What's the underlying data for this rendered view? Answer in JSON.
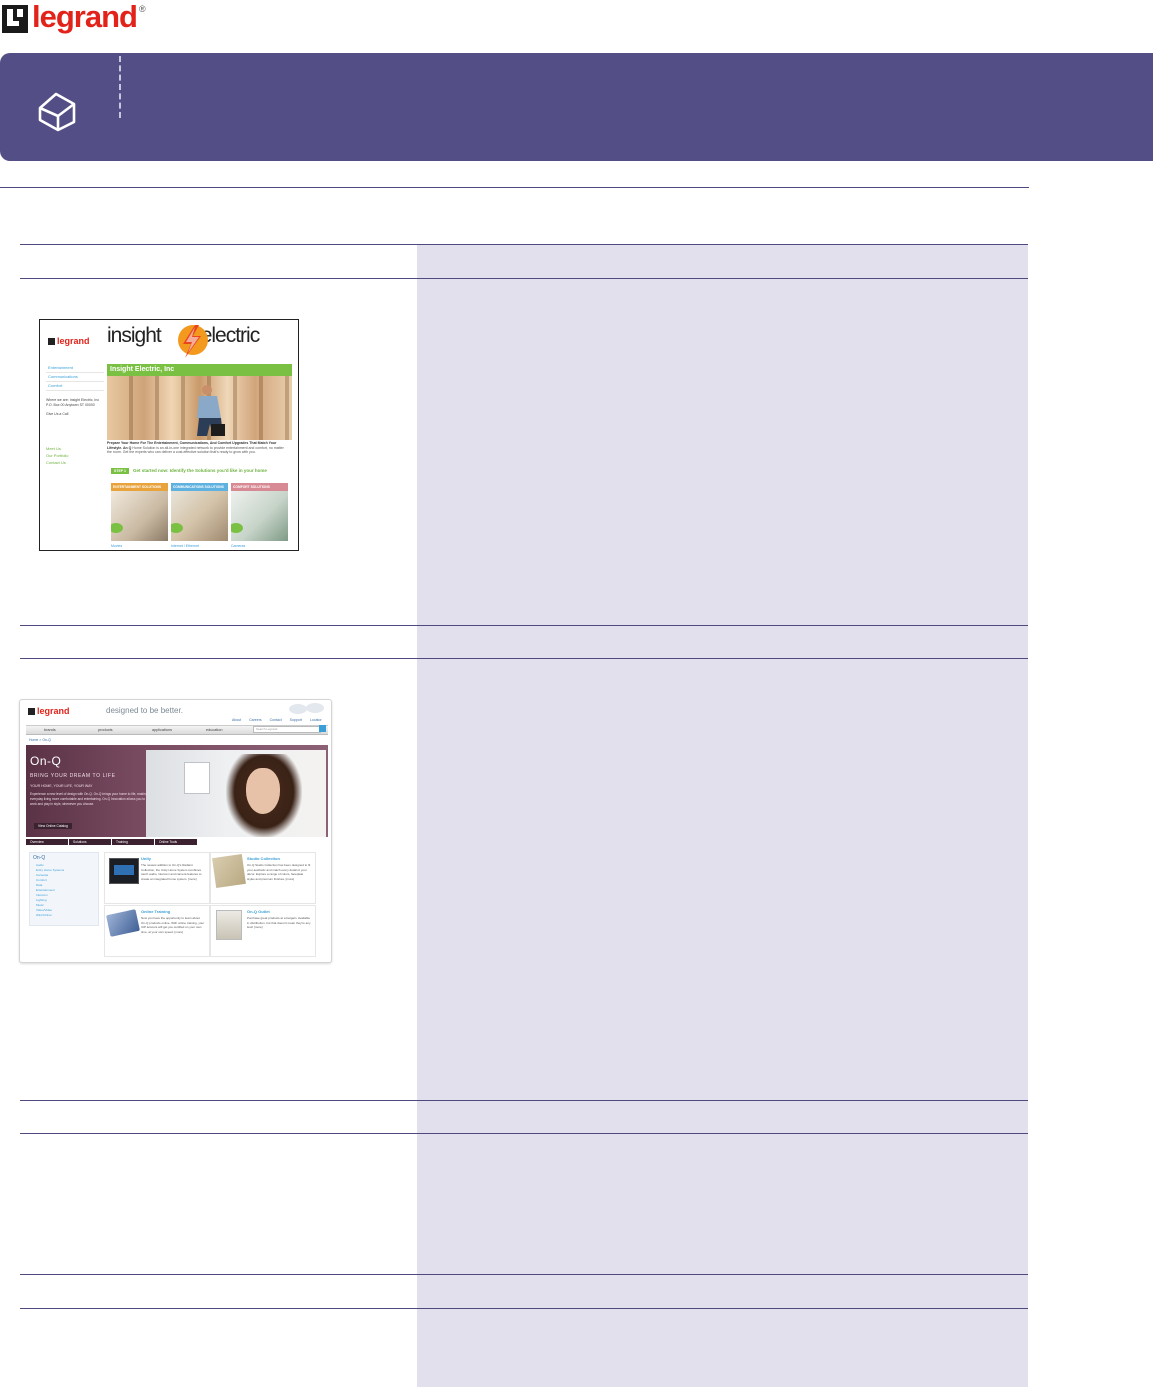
{
  "brand": {
    "logo_text": "legrand",
    "registered": "®",
    "banner_color": "#534e85",
    "panel_color": "#e3e0ee",
    "rule_color": "#4e4a80",
    "icon": "house-icon"
  },
  "insight_site": {
    "logo_text": "legrand",
    "title_left": "insight",
    "title_right": "electric",
    "nav": [
      "Entertainment",
      "Communications",
      "Comfort"
    ],
    "address": "Where we are: Insight Electric, Inc P.O. Box 00 Anytown ST 00000",
    "phone_label": "Give Us a Call",
    "side_links": [
      "Meet Us",
      "Our Portfolio",
      "Contact Us"
    ],
    "heading": "Insight Electric, Inc",
    "intro_bold": "Prepare Your Home For The Entertainment, Communications, And Comfort Upgrades That Match Your Lifestyle. An Q",
    "intro_text": "Home Solution is an all-in-one integrated network to provide entertainment and comfort, no matter the room. Get the experts who can deliver a cost-effective solution that's ready to grow with you.",
    "cta_step": "STEP 1",
    "cta_text": "Get started now: Identify the Solutions you'd like in your home",
    "cards": [
      {
        "header": "ENTERTAINMENT SOLUTIONS",
        "caption": "Movies",
        "color": "#e8a33c"
      },
      {
        "header": "COMMUNICATIONS SOLUTIONS",
        "caption": "Internet / Ethernet",
        "color": "#5fb2e0"
      },
      {
        "header": "COMFORT SOLUTIONS",
        "caption": "Cameras",
        "color": "#d88a94"
      }
    ]
  },
  "onq_site": {
    "logo_text": "legrand",
    "tagline": "designed to be better.",
    "top_links": [
      "About",
      "Careers",
      "Contact",
      "Support",
      "Locator"
    ],
    "nav": [
      "brands",
      "products",
      "applications",
      "education"
    ],
    "search_placeholder": "Search Legrand",
    "breadcrumb": "Home > On-Q",
    "hero_title": "On-Q",
    "hero_subtitle": "BRING YOUR DREAM TO LIFE",
    "hero_subtitle2": "YOUR HOME, YOUR LIFE, YOUR WAY",
    "hero_body": "Experience a new level of design with On-Q. On-Q brings your home to life, making everyday living more comfortable and entertaining. On-Q Innovation allows you to work and play in style, whenever you choose.",
    "hero_button": "View Online Catalog",
    "tabs": [
      "Overview",
      "Solutions",
      "Training",
      "Online Tools"
    ],
    "left_nav_title": "On-Q",
    "left_nav_items": [
      "Audio",
      "Entry Home Systems",
      "Cameras",
      "Comfort",
      "Data",
      "Entertainment",
      "Intercom",
      "Lighting",
      "Music",
      "Video/Video",
      "Wire/Chime"
    ],
    "boxes": [
      {
        "title": "Unity",
        "text": "The newest addition to On-Q's Radiant Collection, the Unity Home System combines touch audio, intercom and camera features to create an integrated home system. [more]"
      },
      {
        "title": "Studio Collection",
        "text": "On-Q Studio Collection has been designed to fit your aesthetic and match every detail of your décor. Explore a range of colors, faceplate styles and premium finishes. [more]"
      },
      {
        "title": "Online Training",
        "text": "Now you have the opportunity to learn about On-Q products online. With online training, your IUP account will get you certified on your own time, at your own speed. [more]"
      },
      {
        "title": "On-Q Outlet",
        "text": "Purchase great products at a bargain. Available in distribution, but that doesn't mean they're any less! [more]"
      }
    ]
  }
}
